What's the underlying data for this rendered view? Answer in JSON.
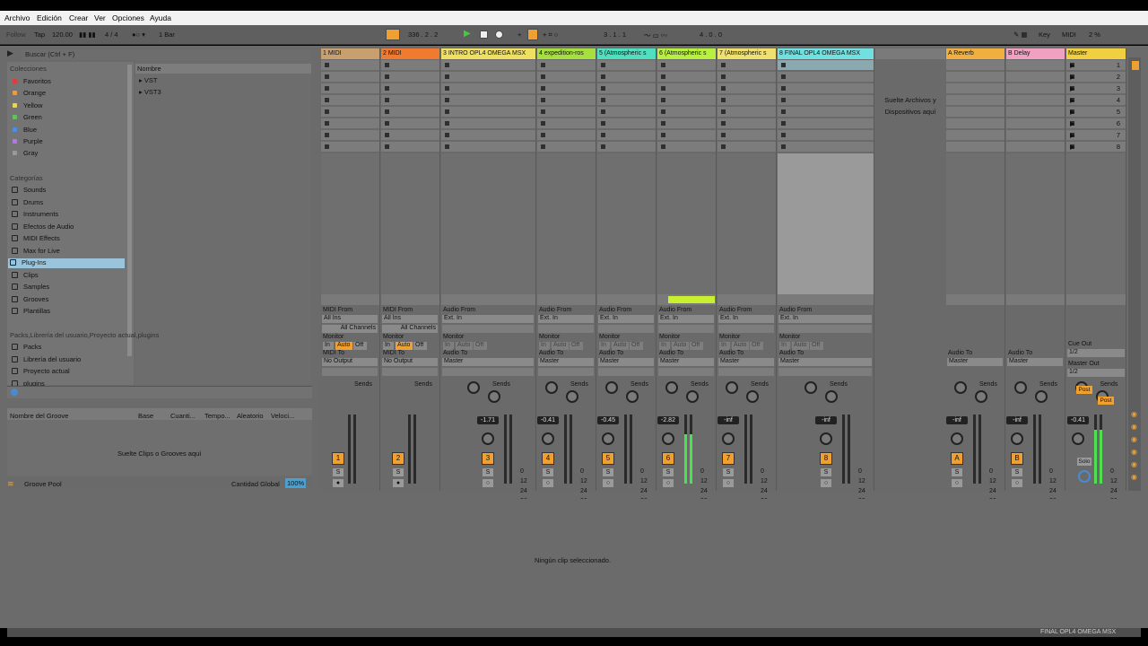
{
  "menu": [
    "Archivo",
    "Edición",
    "Crear",
    "Ver",
    "Opciones",
    "Ayuda"
  ],
  "transport": {
    "follow": "Follow",
    "tap": "Tap",
    "tempo": "120.00",
    "sig": "4 / 4",
    "quant": "1 Bar",
    "position": "336 .  2 .  2",
    "loop_start": "3 .  1 .  1",
    "loop_len": "4 .  0 .  0",
    "key": "Key",
    "midi": "MIDI",
    "cpu": "2 %"
  },
  "browser": {
    "search": "Buscar (Ctrl + F)",
    "colecciones": "Colecciones",
    "categorias": "Categorías",
    "places": [
      "Packs",
      "Librería del usuario",
      "Proyecto actual",
      "plugins"
    ],
    "nombre": "Nombre",
    "collections": [
      {
        "label": "Favoritos",
        "color": "#e03c3c"
      },
      {
        "label": "Orange",
        "color": "#f09a3a"
      },
      {
        "label": "Yellow",
        "color": "#e8d84a"
      },
      {
        "label": "Green",
        "color": "#5ec45e"
      },
      {
        "label": "Blue",
        "color": "#4e8de0"
      },
      {
        "label": "Purple",
        "color": "#b07ae0"
      },
      {
        "label": "Gray",
        "color": "#9a9a9a"
      }
    ],
    "categories": [
      "Sounds",
      "Drums",
      "Instruments",
      "Efectos de Audio",
      "MIDI Effects",
      "Max for Live",
      "Plug-Ins",
      "Clips",
      "Samples",
      "Grooves",
      "Plantillas"
    ],
    "files": [
      "VST",
      "VST3"
    ]
  },
  "groove": {
    "cols": [
      "Nombre del Groove",
      "Base",
      "Cuanti...",
      "Tempo...",
      "Aleatorio",
      "Veloci..."
    ],
    "drop": "Suelte Clips o Grooves aquí",
    "pool": "Groove Pool",
    "amount_label": "Cantidad Global",
    "amount": "100%"
  },
  "tracks": [
    {
      "name": "1 MIDI",
      "color": "#c8a070",
      "num": "1",
      "vol": "",
      "type": "midi"
    },
    {
      "name": "2 MIDI",
      "color": "#f07a30",
      "num": "2",
      "vol": "",
      "type": "midi"
    },
    {
      "name": "3 INTRO OPL4 OMEGA MSX",
      "color": "#f0e060",
      "num": "3",
      "vol": "-1.71",
      "type": "audio"
    },
    {
      "name": "4 expedition-ros",
      "color": "#a6e040",
      "num": "4",
      "vol": "-0.41",
      "type": "audio"
    },
    {
      "name": "5 (Atmospheric s",
      "color": "#50e0c0",
      "num": "5",
      "vol": "-0.45",
      "type": "audio"
    },
    {
      "name": "6 (Atmospheric s",
      "color": "#b8f040",
      "num": "6",
      "vol": "-2.82",
      "type": "audio"
    },
    {
      "name": "7 (Atmospheric s",
      "color": "#f0e070",
      "num": "7",
      "vol": "-inf",
      "type": "audio"
    },
    {
      "name": "8 FINAL OPL4 OMEGA MSX",
      "color": "#70e0e0",
      "num": "8",
      "vol": "-inf",
      "type": "audio"
    }
  ],
  "returns": [
    {
      "name": "A Reverb",
      "color": "#f0b040",
      "num": "A",
      "vol": "-inf"
    },
    {
      "name": "B Delay",
      "color": "#f0a0c0",
      "num": "B",
      "vol": "-inf"
    }
  ],
  "master": {
    "name": "Master",
    "color": "#f0d040",
    "vol": "-0.41",
    "scenes": [
      "1",
      "2",
      "3",
      "4",
      "5",
      "6",
      "7",
      "8"
    ],
    "cue_out": "Cue Out",
    "cue_val": "1/2",
    "master_out": "Master Out",
    "master_val": "1/2",
    "solo": "Solo",
    "post": "Post"
  },
  "io": {
    "midi_from": "MIDI From",
    "audio_from": "Audio From",
    "all_ins": "All Ins",
    "all_channels": "All Channels",
    "ext_in": "Ext. In",
    "monitor": "Monitor",
    "in": "In",
    "auto": "Auto",
    "off": "Off",
    "midi_to": "MIDI To",
    "audio_to": "Audio To",
    "no_output": "No Output",
    "master": "Master",
    "sends": "Sends"
  },
  "drop_area": "Suelte Archivos y Dispositivos aquí",
  "scale": [
    "0",
    "12",
    "24",
    "36",
    "48",
    "60"
  ],
  "detail": "Ningún clip seleccionado.",
  "status": "FINAL OPL4 OMEGA MSX"
}
